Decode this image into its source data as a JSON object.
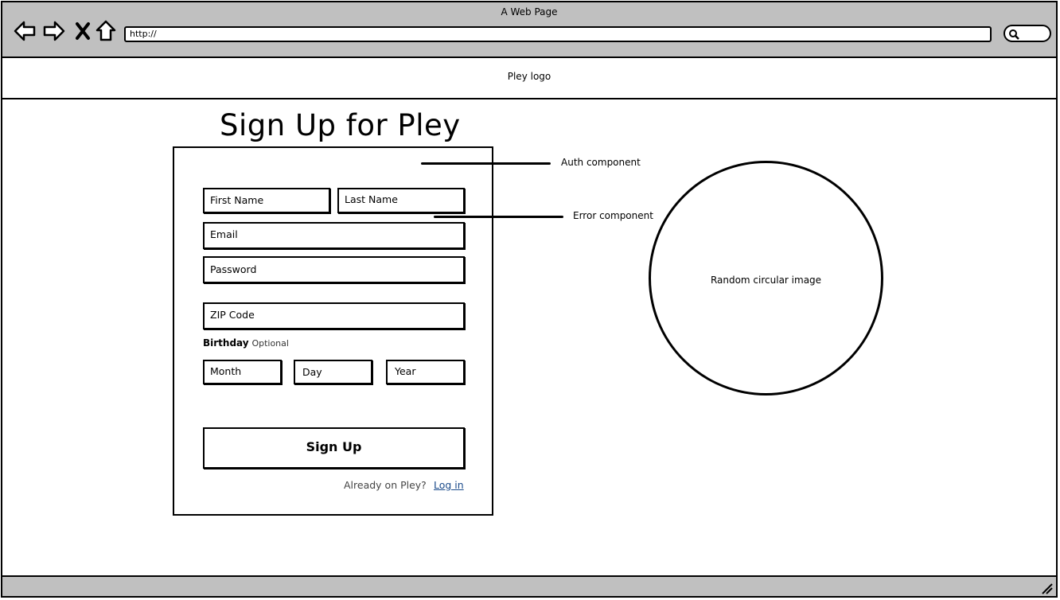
{
  "browser": {
    "window_title": "A Web Page",
    "url": "http://",
    "nav_icons": [
      "back-arrow-icon",
      "forward-arrow-icon",
      "close-x-icon",
      "home-icon"
    ]
  },
  "header": {
    "logo_text": "Pley logo"
  },
  "page": {
    "title": "Sign Up for Pley"
  },
  "form": {
    "first_name_placeholder": "First Name",
    "last_name_placeholder": "Last Name",
    "email_placeholder": "Email",
    "password_placeholder": "Password",
    "zip_placeholder": "ZIP Code",
    "birthday_label": "Birthday",
    "birthday_optional": "Optional",
    "month_placeholder": "Month",
    "day_placeholder": "Day",
    "year_placeholder": "Year",
    "submit_label": "Sign Up",
    "already_text": "Already on Pley?",
    "login_link": "Log in"
  },
  "annotations": {
    "auth_component": "Auth component",
    "error_component": "Error component"
  },
  "image_placeholder": {
    "label": "Random circular image"
  }
}
